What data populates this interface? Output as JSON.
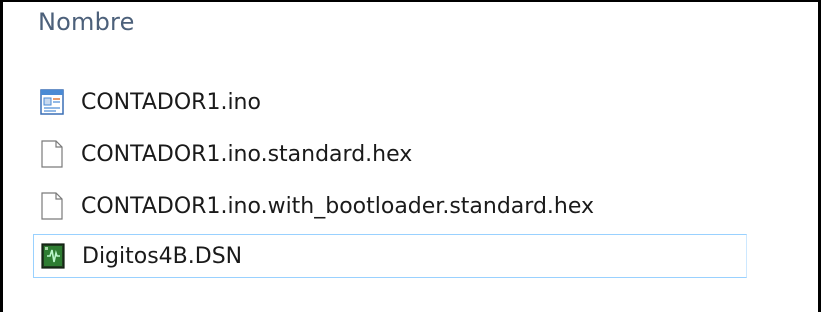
{
  "header": {
    "column_name": "Nombre"
  },
  "files": [
    {
      "name": "CONTADOR1.ino",
      "icon": "arduino-sketch-file-icon"
    },
    {
      "name": "CONTADOR1.ino.standard.hex",
      "icon": "generic-file-icon"
    },
    {
      "name": "CONTADOR1.ino.with_bootloader.standard.hex",
      "icon": "generic-file-icon"
    },
    {
      "name": "Digitos4B.DSN",
      "icon": "proteus-design-file-icon",
      "selected": true
    }
  ],
  "colors": {
    "header_text": "#4c607a",
    "selection_border": "#99d1ff"
  }
}
